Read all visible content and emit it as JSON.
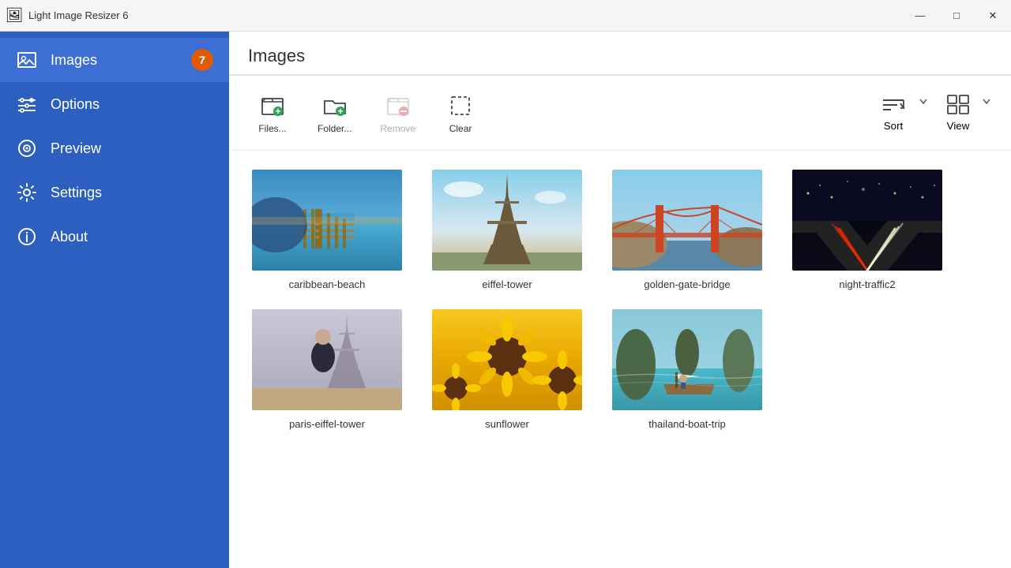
{
  "titleBar": {
    "title": "Light Image Resizer 6",
    "icon": "🖼",
    "minimizeLabel": "—",
    "maximizeLabel": "□",
    "closeLabel": "✕"
  },
  "sidebar": {
    "items": [
      {
        "id": "images",
        "label": "Images",
        "badge": "7",
        "active": true
      },
      {
        "id": "options",
        "label": "Options",
        "badge": null
      },
      {
        "id": "preview",
        "label": "Preview",
        "badge": null
      },
      {
        "id": "settings",
        "label": "Settings",
        "badge": null
      },
      {
        "id": "about",
        "label": "About",
        "badge": null
      }
    ]
  },
  "main": {
    "title": "Images",
    "toolbar": {
      "filesLabel": "Files...",
      "folderLabel": "Folder...",
      "removeLabel": "Remove",
      "clearLabel": "Clear",
      "sortLabel": "Sort",
      "viewLabel": "View"
    },
    "images": [
      {
        "id": "caribbean-beach",
        "name": "caribbean-beach",
        "colorClass": "img-caribbean"
      },
      {
        "id": "eiffel-tower",
        "name": "eiffel-tower",
        "colorClass": "img-eiffel"
      },
      {
        "id": "golden-gate-bridge",
        "name": "golden-gate-bridge",
        "colorClass": "img-golden-gate"
      },
      {
        "id": "night-traffic2",
        "name": "night-traffic2",
        "colorClass": "img-night-traffic"
      },
      {
        "id": "paris-eiffel-tower",
        "name": "paris-eiffel-tower",
        "colorClass": "img-paris-eiffel"
      },
      {
        "id": "sunflower",
        "name": "sunflower",
        "colorClass": "img-sunflower"
      },
      {
        "id": "thailand-boat-trip",
        "name": "thailand-boat-trip",
        "colorClass": "img-thailand"
      }
    ]
  }
}
